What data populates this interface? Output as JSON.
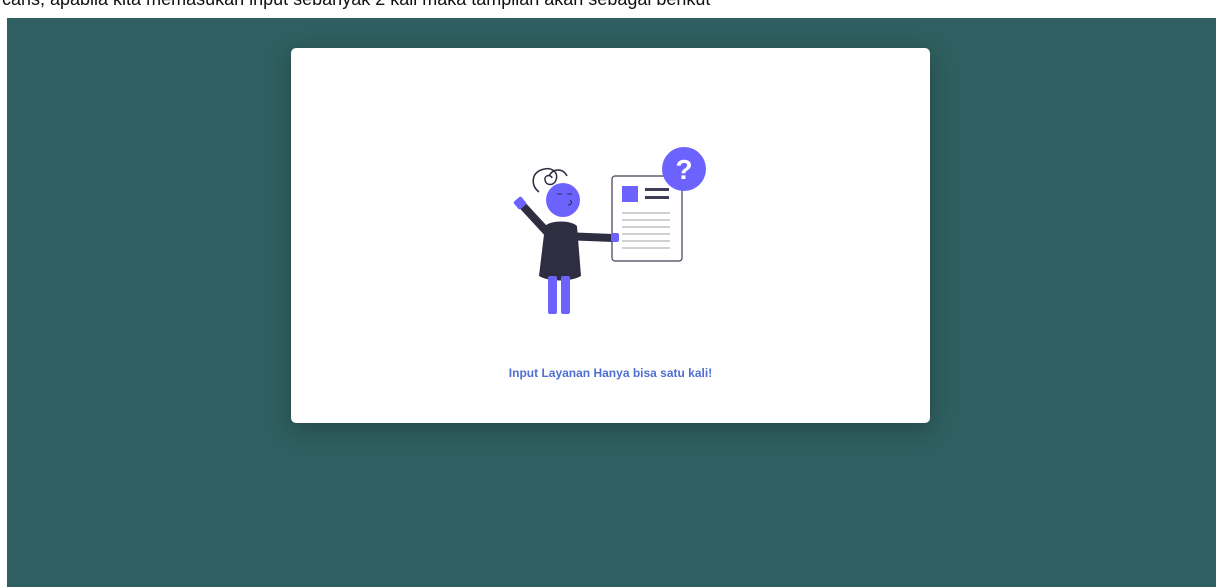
{
  "background_doc": {
    "partial_text": "caris, apabila kita memasukan input sebanyak 2 kali maka tampilan akan sebagai berikut"
  },
  "modal": {
    "message": "Input Layanan Hanya bisa satu kali!",
    "illustration_icon": "person-question-document-icon"
  },
  "colors": {
    "overlay": "#2f5f60",
    "modal_bg": "#ffffff",
    "accent": "#6c63ff",
    "message_text": "#4f6fd6",
    "figure_dark": "#2f2e41"
  }
}
